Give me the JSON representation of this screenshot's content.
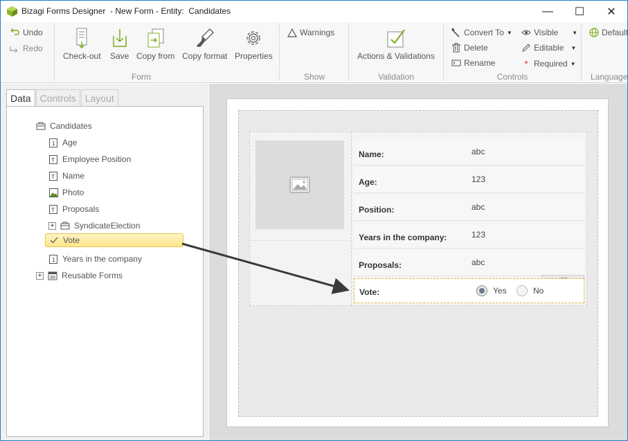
{
  "window": {
    "title": "Bizagi Forms Designer  - New Form - Entity:  Candidates",
    "minimize": "—",
    "maximize": "☐",
    "close": "✕"
  },
  "ribbon": {
    "undo": "Undo",
    "redo": "Redo",
    "form_group": {
      "label": "Form",
      "buttons": [
        "Check-out",
        "Save",
        "Copy from",
        "Copy format",
        "Properties"
      ]
    },
    "show_group": {
      "label": "Show",
      "warnings": "Warnings"
    },
    "validation_group": {
      "label": "Validation",
      "actions": "Actions & Validations"
    },
    "controls_group": {
      "label": "Controls",
      "convert_to": "Convert To",
      "delete": "Delete",
      "rename": "Rename",
      "visible": "Visible",
      "editable": "Editable",
      "required": "Required"
    },
    "language_group": {
      "label": "Language",
      "default": "Default"
    }
  },
  "left_panel": {
    "tabs": [
      "Data",
      "Controls",
      "Layout"
    ],
    "active_tab": "Data",
    "tree": {
      "root": "Candidates",
      "items": [
        "Age",
        "Employee Position",
        "Name",
        "Photo",
        "Proposals",
        "SyndicateElection",
        "Vote",
        "Years in the company"
      ],
      "reusable": "Reusable Forms",
      "selected": "Vote"
    }
  },
  "form": {
    "fields": [
      {
        "label": "Name:",
        "value": "abc"
      },
      {
        "label": "Age:",
        "value": "123"
      },
      {
        "label": "Position:",
        "value": "abc"
      },
      {
        "label": "Years in the company:",
        "value": "123"
      },
      {
        "label": "Proposals:",
        "value": "abc"
      }
    ],
    "vote": {
      "label": "Vote:",
      "options": [
        "Yes",
        "No"
      ],
      "selected": "Yes"
    }
  },
  "colors": {
    "accent_green": "#7cab1f",
    "selection_yellow": "#fde58a",
    "window_border": "#1f7fc7"
  }
}
